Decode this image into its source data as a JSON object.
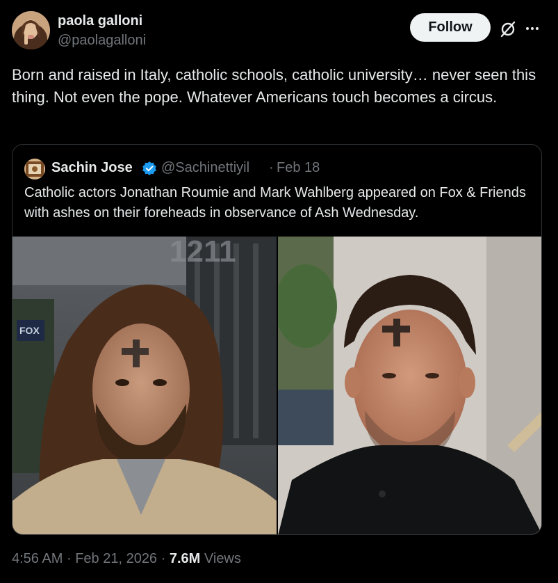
{
  "author": {
    "name": "paola galloni",
    "handle": "@paolagalloni"
  },
  "actions": {
    "follow_label": "Follow",
    "grok_icon": "grok-icon",
    "more_icon": "more-icon"
  },
  "tweet": {
    "text": "Born and raised in Italy, catholic schools, catholic university… never seen this thing. Not even the pope. Whatever Americans touch becomes a circus."
  },
  "quote": {
    "name": "Sachin Jose",
    "verified": true,
    "handle": "@Sachinettiyil",
    "separator": "·",
    "date": "Feb 18",
    "text": "Catholic actors Jonathan Roumie and Mark Wahlberg appeared on Fox & Friends with ashes on their foreheads in observance of Ash Wednesday.",
    "photo_sign_text": "FOX",
    "photo_building_text": "1211"
  },
  "meta": {
    "time": "4:56 AM",
    "sep1": "·",
    "date": "Feb 21, 2026",
    "sep2": "·",
    "views_count": "7.6M",
    "views_label": "Views"
  },
  "colors": {
    "background": "#000000",
    "text": "#e7e9ea",
    "secondary": "#71767b",
    "border": "#2f3336",
    "verified": "#1d9bf0",
    "follow_bg": "#eff3f4"
  }
}
